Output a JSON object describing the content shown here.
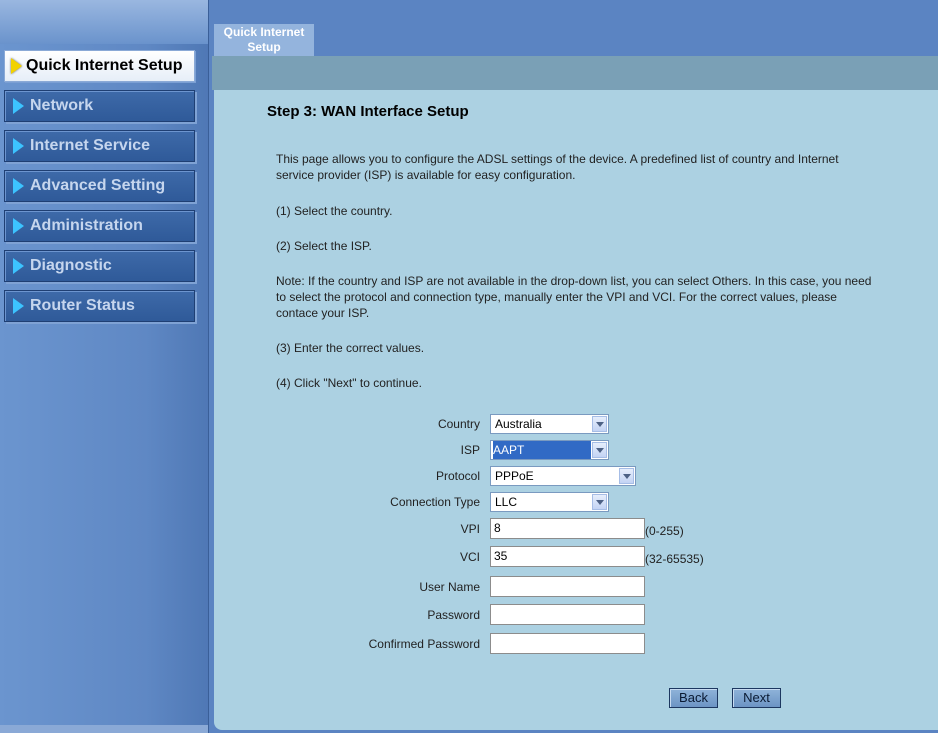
{
  "sidebar": {
    "items": [
      {
        "label": "Quick Internet Setup"
      },
      {
        "label": "Network"
      },
      {
        "label": "Internet Service"
      },
      {
        "label": "Advanced Setting"
      },
      {
        "label": "Administration"
      },
      {
        "label": "Diagnostic"
      },
      {
        "label": "Router Status"
      }
    ]
  },
  "tab": {
    "line1": "Quick Internet",
    "line2": "Setup"
  },
  "page": {
    "heading": "Step 3: WAN Interface Setup",
    "intro": "This page allows you to configure the ADSL settings of the device. A predefined list of country and Internet service provider (ISP) is available for easy configuration.",
    "step1": "(1) Select the country.",
    "step2": "(2) Select the ISP.",
    "note": "Note: If the country and ISP are not available in the drop-down list, you can select Others. In this case, you need to select the protocol and connection type, manually enter the VPI and VCI. For the correct values, please contace your ISP.",
    "step3": "(3) Enter the correct values.",
    "step4": "(4) Click \"Next\" to continue."
  },
  "form": {
    "country": {
      "label": "Country",
      "value": "Australia"
    },
    "isp": {
      "label": "ISP",
      "value": "AAPT"
    },
    "protocol": {
      "label": "Protocol",
      "value": "PPPoE"
    },
    "connection_type": {
      "label": "Connection Type",
      "value": "LLC"
    },
    "vpi": {
      "label": "VPI",
      "value": "8",
      "range": "(0-255)"
    },
    "vci": {
      "label": "VCI",
      "value": "35",
      "range": "(32-65535)"
    },
    "username": {
      "label": "User Name",
      "value": ""
    },
    "password": {
      "label": "Password",
      "value": ""
    },
    "confirm_password": {
      "label": "Confirmed Password",
      "value": ""
    }
  },
  "buttons": {
    "back": "Back",
    "next": "Next"
  }
}
